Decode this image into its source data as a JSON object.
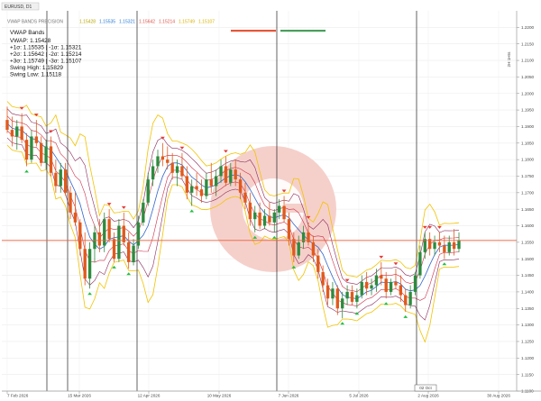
{
  "window": {
    "symbol_tab": "EURUSD, D1",
    "indicator_title": "VWAP BANDS PRECISION",
    "header_values": [
      "1.15428",
      "1.15535",
      "1.15321",
      "1.15642",
      "1.15214",
      "1.15749",
      "1.15107"
    ],
    "header_value_colors": [
      "#b8a600",
      "#2a7bd6",
      "#2a7bd6",
      "#e0554a",
      "#e0554a",
      "#d9b300",
      "#d9b300"
    ],
    "header_value_mode_label": "",
    "header_toggle_colors": [
      "#e4573a",
      "#4a9e5c"
    ],
    "vertical_axis_tag": "2H 1Hrs",
    "price_tag": "1.15555",
    "time_tag": "02 Oct",
    "watermark_icon": "copyright-style-logo-icon"
  },
  "legend": {
    "title": "VWAP Bands",
    "lines": [
      "VWAP: 1.15428",
      "+1σ: 1.15535 | -1σ: 1.15321",
      "+2σ: 1.15642 | -2σ: 1.15214",
      "+3σ: 1.15749 | -3σ: 1.15107",
      "Swing High: 1.15829",
      "Swing Low: 1.15118"
    ]
  },
  "chart_data": {
    "type": "candlestick",
    "instrument": "EURUSD",
    "timeframe": "D1",
    "ylim": [
      1.11,
      1.225
    ],
    "y_ticks": [
      "1.1100",
      "1.1150",
      "1.1200",
      "1.1250",
      "1.1300",
      "1.1350",
      "1.1400",
      "1.1450",
      "1.1500",
      "1.1550",
      "1.1600",
      "1.1650",
      "1.1700",
      "1.1750",
      "1.1800",
      "1.1850",
      "1.1900",
      "1.1950",
      "1.2000",
      "1.2050",
      "1.2100",
      "1.2150",
      "1.2200"
    ],
    "x_ticks": [
      "7 Feb 2026",
      "15 Mar 2026",
      "12 Apr 2026",
      "10 May 2026",
      "7 Jun 2026",
      "5 Jul 2026",
      "2 Aug 2026",
      "30 Aug 2026"
    ],
    "period_separators": [
      "15 Mar 2026",
      "12 Apr 2026",
      "7 Jun 2026",
      "2 Aug 2026"
    ],
    "current_price": 1.15555,
    "grid": true,
    "legend_position": "top-left",
    "colors": {
      "bull": "#2e8b3e",
      "bear": "#e05a1c",
      "vwap": "#3366cc",
      "band1": "#cc2e4a",
      "band2": "#8a2a5a",
      "band3": "#f2c300",
      "swing_high": "#e53935",
      "swing_low": "#20c040",
      "current": "#e9603c"
    },
    "candles_note": "approximate OHLC read from the chart",
    "candles": [
      {
        "o": 1.192,
        "h": 1.196,
        "l": 1.188,
        "c": 1.189
      },
      {
        "o": 1.189,
        "h": 1.193,
        "l": 1.184,
        "c": 1.187
      },
      {
        "o": 1.187,
        "h": 1.192,
        "l": 1.183,
        "c": 1.19
      },
      {
        "o": 1.19,
        "h": 1.194,
        "l": 1.185,
        "c": 1.186
      },
      {
        "o": 1.186,
        "h": 1.188,
        "l": 1.178,
        "c": 1.18
      },
      {
        "o": 1.18,
        "h": 1.189,
        "l": 1.179,
        "c": 1.187
      },
      {
        "o": 1.187,
        "h": 1.192,
        "l": 1.184,
        "c": 1.185
      },
      {
        "o": 1.185,
        "h": 1.187,
        "l": 1.178,
        "c": 1.179
      },
      {
        "o": 1.179,
        "h": 1.186,
        "l": 1.177,
        "c": 1.184
      },
      {
        "o": 1.184,
        "h": 1.187,
        "l": 1.175,
        "c": 1.176
      },
      {
        "o": 1.176,
        "h": 1.18,
        "l": 1.17,
        "c": 1.172
      },
      {
        "o": 1.172,
        "h": 1.179,
        "l": 1.17,
        "c": 1.177
      },
      {
        "o": 1.177,
        "h": 1.179,
        "l": 1.169,
        "c": 1.17
      },
      {
        "o": 1.17,
        "h": 1.172,
        "l": 1.162,
        "c": 1.164
      },
      {
        "o": 1.164,
        "h": 1.17,
        "l": 1.16,
        "c": 1.161
      },
      {
        "o": 1.161,
        "h": 1.162,
        "l": 1.151,
        "c": 1.153
      },
      {
        "o": 1.153,
        "h": 1.158,
        "l": 1.142,
        "c": 1.144
      },
      {
        "o": 1.144,
        "h": 1.155,
        "l": 1.141,
        "c": 1.153
      },
      {
        "o": 1.153,
        "h": 1.16,
        "l": 1.149,
        "c": 1.158
      },
      {
        "o": 1.158,
        "h": 1.162,
        "l": 1.152,
        "c": 1.154
      },
      {
        "o": 1.154,
        "h": 1.164,
        "l": 1.152,
        "c": 1.162
      },
      {
        "o": 1.162,
        "h": 1.165,
        "l": 1.155,
        "c": 1.156
      },
      {
        "o": 1.156,
        "h": 1.158,
        "l": 1.149,
        "c": 1.15
      },
      {
        "o": 1.15,
        "h": 1.162,
        "l": 1.149,
        "c": 1.16
      },
      {
        "o": 1.16,
        "h": 1.164,
        "l": 1.154,
        "c": 1.155
      },
      {
        "o": 1.155,
        "h": 1.158,
        "l": 1.147,
        "c": 1.149
      },
      {
        "o": 1.149,
        "h": 1.156,
        "l": 1.148,
        "c": 1.154
      },
      {
        "o": 1.154,
        "h": 1.163,
        "l": 1.153,
        "c": 1.161
      },
      {
        "o": 1.161,
        "h": 1.168,
        "l": 1.16,
        "c": 1.167
      },
      {
        "o": 1.167,
        "h": 1.176,
        "l": 1.166,
        "c": 1.174
      },
      {
        "o": 1.174,
        "h": 1.18,
        "l": 1.172,
        "c": 1.178
      },
      {
        "o": 1.178,
        "h": 1.183,
        "l": 1.176,
        "c": 1.181
      },
      {
        "o": 1.181,
        "h": 1.185,
        "l": 1.178,
        "c": 1.18
      },
      {
        "o": 1.18,
        "h": 1.184,
        "l": 1.177,
        "c": 1.179
      },
      {
        "o": 1.179,
        "h": 1.182,
        "l": 1.174,
        "c": 1.176
      },
      {
        "o": 1.176,
        "h": 1.18,
        "l": 1.172,
        "c": 1.178
      },
      {
        "o": 1.178,
        "h": 1.182,
        "l": 1.174,
        "c": 1.175
      },
      {
        "o": 1.175,
        "h": 1.178,
        "l": 1.168,
        "c": 1.17
      },
      {
        "o": 1.17,
        "h": 1.174,
        "l": 1.166,
        "c": 1.172
      },
      {
        "o": 1.172,
        "h": 1.176,
        "l": 1.169,
        "c": 1.171
      },
      {
        "o": 1.171,
        "h": 1.174,
        "l": 1.167,
        "c": 1.169
      },
      {
        "o": 1.169,
        "h": 1.176,
        "l": 1.168,
        "c": 1.174
      },
      {
        "o": 1.174,
        "h": 1.179,
        "l": 1.17,
        "c": 1.172
      },
      {
        "o": 1.172,
        "h": 1.177,
        "l": 1.169,
        "c": 1.175
      },
      {
        "o": 1.175,
        "h": 1.18,
        "l": 1.173,
        "c": 1.178
      },
      {
        "o": 1.178,
        "h": 1.181,
        "l": 1.172,
        "c": 1.173
      },
      {
        "o": 1.173,
        "h": 1.179,
        "l": 1.172,
        "c": 1.177
      },
      {
        "o": 1.177,
        "h": 1.18,
        "l": 1.172,
        "c": 1.174
      },
      {
        "o": 1.174,
        "h": 1.176,
        "l": 1.168,
        "c": 1.17
      },
      {
        "o": 1.17,
        "h": 1.173,
        "l": 1.165,
        "c": 1.167
      },
      {
        "o": 1.167,
        "h": 1.17,
        "l": 1.16,
        "c": 1.162
      },
      {
        "o": 1.162,
        "h": 1.166,
        "l": 1.158,
        "c": 1.164
      },
      {
        "o": 1.164,
        "h": 1.167,
        "l": 1.159,
        "c": 1.16
      },
      {
        "o": 1.16,
        "h": 1.165,
        "l": 1.159,
        "c": 1.163
      },
      {
        "o": 1.163,
        "h": 1.167,
        "l": 1.16,
        "c": 1.161
      },
      {
        "o": 1.161,
        "h": 1.165,
        "l": 1.158,
        "c": 1.164
      },
      {
        "o": 1.164,
        "h": 1.168,
        "l": 1.162,
        "c": 1.166
      },
      {
        "o": 1.166,
        "h": 1.169,
        "l": 1.161,
        "c": 1.162
      },
      {
        "o": 1.162,
        "h": 1.164,
        "l": 1.154,
        "c": 1.156
      },
      {
        "o": 1.156,
        "h": 1.158,
        "l": 1.149,
        "c": 1.151
      },
      {
        "o": 1.151,
        "h": 1.157,
        "l": 1.15,
        "c": 1.155
      },
      {
        "o": 1.155,
        "h": 1.16,
        "l": 1.153,
        "c": 1.158
      },
      {
        "o": 1.158,
        "h": 1.161,
        "l": 1.154,
        "c": 1.155
      },
      {
        "o": 1.155,
        "h": 1.157,
        "l": 1.149,
        "c": 1.151
      },
      {
        "o": 1.151,
        "h": 1.153,
        "l": 1.144,
        "c": 1.146
      },
      {
        "o": 1.146,
        "h": 1.148,
        "l": 1.14,
        "c": 1.142
      },
      {
        "o": 1.142,
        "h": 1.144,
        "l": 1.136,
        "c": 1.138
      },
      {
        "o": 1.138,
        "h": 1.143,
        "l": 1.136,
        "c": 1.141
      },
      {
        "o": 1.141,
        "h": 1.142,
        "l": 1.133,
        "c": 1.135
      },
      {
        "o": 1.135,
        "h": 1.14,
        "l": 1.132,
        "c": 1.138
      },
      {
        "o": 1.138,
        "h": 1.142,
        "l": 1.136,
        "c": 1.14
      },
      {
        "o": 1.14,
        "h": 1.142,
        "l": 1.136,
        "c": 1.137
      },
      {
        "o": 1.137,
        "h": 1.141,
        "l": 1.135,
        "c": 1.139
      },
      {
        "o": 1.139,
        "h": 1.145,
        "l": 1.138,
        "c": 1.143
      },
      {
        "o": 1.143,
        "h": 1.146,
        "l": 1.139,
        "c": 1.141
      },
      {
        "o": 1.141,
        "h": 1.144,
        "l": 1.139,
        "c": 1.142
      },
      {
        "o": 1.142,
        "h": 1.147,
        "l": 1.14,
        "c": 1.145
      },
      {
        "o": 1.145,
        "h": 1.149,
        "l": 1.142,
        "c": 1.144
      },
      {
        "o": 1.144,
        "h": 1.146,
        "l": 1.138,
        "c": 1.14
      },
      {
        "o": 1.14,
        "h": 1.144,
        "l": 1.139,
        "c": 1.143
      },
      {
        "o": 1.143,
        "h": 1.147,
        "l": 1.141,
        "c": 1.142
      },
      {
        "o": 1.142,
        "h": 1.145,
        "l": 1.137,
        "c": 1.139
      },
      {
        "o": 1.139,
        "h": 1.141,
        "l": 1.134,
        "c": 1.136
      },
      {
        "o": 1.136,
        "h": 1.142,
        "l": 1.135,
        "c": 1.14
      },
      {
        "o": 1.14,
        "h": 1.146,
        "l": 1.139,
        "c": 1.145
      },
      {
        "o": 1.145,
        "h": 1.154,
        "l": 1.144,
        "c": 1.152
      },
      {
        "o": 1.152,
        "h": 1.158,
        "l": 1.15,
        "c": 1.156
      },
      {
        "o": 1.156,
        "h": 1.158,
        "l": 1.151,
        "c": 1.153
      },
      {
        "o": 1.153,
        "h": 1.157,
        "l": 1.151,
        "c": 1.155
      },
      {
        "o": 1.155,
        "h": 1.158,
        "l": 1.152,
        "c": 1.154
      },
      {
        "o": 1.154,
        "h": 1.157,
        "l": 1.15,
        "c": 1.152
      },
      {
        "o": 1.152,
        "h": 1.157,
        "l": 1.151,
        "c": 1.155
      },
      {
        "o": 1.155,
        "h": 1.159,
        "l": 1.151,
        "c": 1.153
      },
      {
        "o": 1.153,
        "h": 1.158,
        "l": 1.152,
        "c": 1.1555
      }
    ]
  }
}
